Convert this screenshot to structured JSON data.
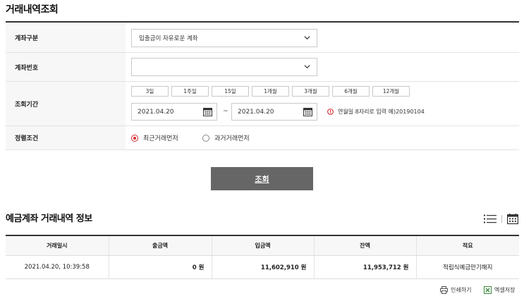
{
  "page": {
    "title": "거래내역조회"
  },
  "form": {
    "account_type": {
      "label": "계좌구분",
      "value": "입출금이 자유로운 계좌"
    },
    "account_number": {
      "label": "계좌번호",
      "value": ""
    },
    "period": {
      "label": "조회기간",
      "buttons": [
        "3일",
        "1주일",
        "15일",
        "1개월",
        "3개월",
        "6개월",
        "12개월"
      ],
      "start_date": "2021.04.20",
      "separator": "~",
      "end_date": "2021.04.20",
      "hint": "연월일 8자리로 입력 예)20190104"
    },
    "sort": {
      "label": "정렬조건",
      "options": [
        {
          "label": "최근거래먼저",
          "selected": true
        },
        {
          "label": "과거거래먼저",
          "selected": false
        }
      ]
    },
    "submit_label": "조회"
  },
  "results": {
    "title": "예금계좌 거래내역 정보",
    "columns": [
      "거래일시",
      "출금액",
      "입금액",
      "잔액",
      "적요"
    ],
    "rows": [
      {
        "datetime": "2021.04.20, 10:39:58",
        "withdrawal": "0",
        "deposit": "11,602,910",
        "balance": "11,953,712",
        "unit": "원",
        "memo": "적립식예금만기해지"
      }
    ],
    "actions": {
      "print": "인쇄하기",
      "excel": "엑셀저장"
    }
  },
  "colors": {
    "accent": "#d8262b",
    "button": "#666666",
    "excel": "#3a8a3a"
  },
  "icons": [
    "chevron-down-icon",
    "calendar-icon",
    "info-icon",
    "list-icon",
    "print-icon",
    "excel-icon"
  ]
}
